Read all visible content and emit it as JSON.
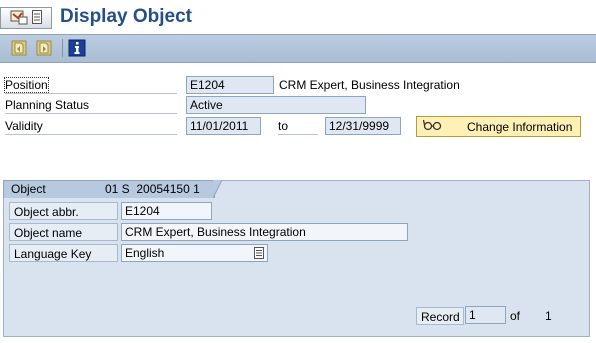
{
  "window": {
    "title": "Display Object"
  },
  "toolbar": {
    "icons": [
      "previous-object-icon",
      "next-object-icon",
      "info-icon"
    ]
  },
  "header": {
    "position_label": "Position",
    "position_value": "E1204",
    "position_description": "CRM Expert,  Business Integration",
    "planning_status_label": "Planning Status",
    "planning_status_value": "Active",
    "validity_label": "Validity",
    "validity_from": "11/01/2011",
    "validity_to_label": "to",
    "validity_to": "12/31/9999",
    "change_info_label": "Change Information"
  },
  "object_section": {
    "tab_label": "Object",
    "tab_id": "01 S  20054150 1",
    "abbr_label": "Object abbr.",
    "abbr_value": "E1204",
    "name_label": "Object name",
    "name_value": "CRM Expert,  Business Integration",
    "language_label": "Language Key",
    "language_value": "English",
    "record_label": "Record",
    "record_value": "1",
    "of_label": "of",
    "record_total": "1"
  },
  "colors": {
    "title": "#24508a",
    "toolbar": "#b3c5da",
    "field": "#dfe8f2",
    "panel": "#d8e3ef",
    "button": "#fff1b5"
  }
}
